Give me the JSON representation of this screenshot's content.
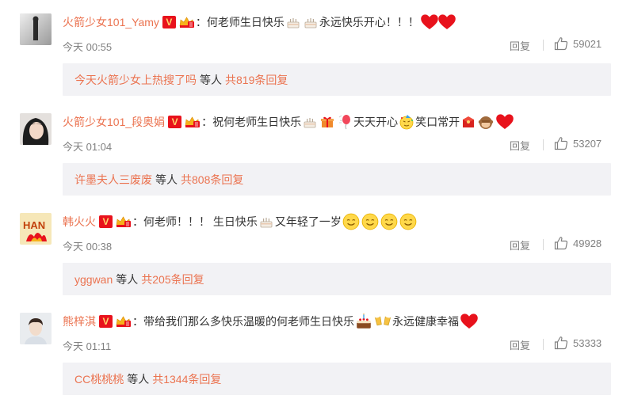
{
  "comments": [
    {
      "username": "火箭少女101_Yamy",
      "text_parts": [
        "：何老师生日快乐",
        "永远快乐开心！！！"
      ],
      "time": "今天 00:55",
      "reply_label": "回复",
      "likes": "59021",
      "sub_reply_user": "今天火箭少女上热搜了吗",
      "sub_reply_mid": "等人",
      "sub_reply_count": "共819条回复",
      "emojis": [
        "cake-icon",
        "cake-icon",
        "heart-icon",
        "heart-icon"
      ]
    },
    {
      "username": "火箭少女101_段奥娟",
      "text_parts": [
        "：祝何老师生日快乐",
        "天天开心",
        "笑口常开"
      ],
      "time": "今天 01:04",
      "reply_label": "回复",
      "likes": "53207",
      "sub_reply_user": "许墨夫人三废废",
      "sub_reply_mid": "等人",
      "sub_reply_count": "共808条回复",
      "emojis": [
        "cake-icon",
        "gift-icon",
        "balloon-icon",
        "party-face-icon",
        "red-envelope-icon",
        "monkey-icon",
        "heart-icon"
      ]
    },
    {
      "username": "韩火火",
      "text_parts": [
        "：何老师！！！ 生日快乐",
        "又年轻了一岁"
      ],
      "time": "今天 00:38",
      "reply_label": "回复",
      "likes": "49928",
      "sub_reply_user": "yggwan",
      "sub_reply_mid": "等人",
      "sub_reply_count": "共205条回复",
      "emojis": [
        "cake-icon",
        "smile-icon",
        "smile-icon",
        "smile-icon",
        "smile-icon"
      ]
    },
    {
      "username": "熊梓淇",
      "text_parts": [
        "：带给我们那么多快乐温暖的何老师生日快乐",
        "永远健康幸福"
      ],
      "time": "今天 01:11",
      "reply_label": "回复",
      "likes": "53333",
      "sub_reply_user": "CC桃桃桃",
      "sub_reply_mid": "等人",
      "sub_reply_count": "共1344条回复",
      "emojis": [
        "birthday-cake-icon",
        "cheers-icon",
        "heart-icon"
      ]
    }
  ],
  "badges": {
    "verified_letter": "V"
  },
  "colors": {
    "username": "#eb7350",
    "meta": "#808080",
    "subreply_bg": "#f2f2f5",
    "heart": "#e8121c"
  }
}
